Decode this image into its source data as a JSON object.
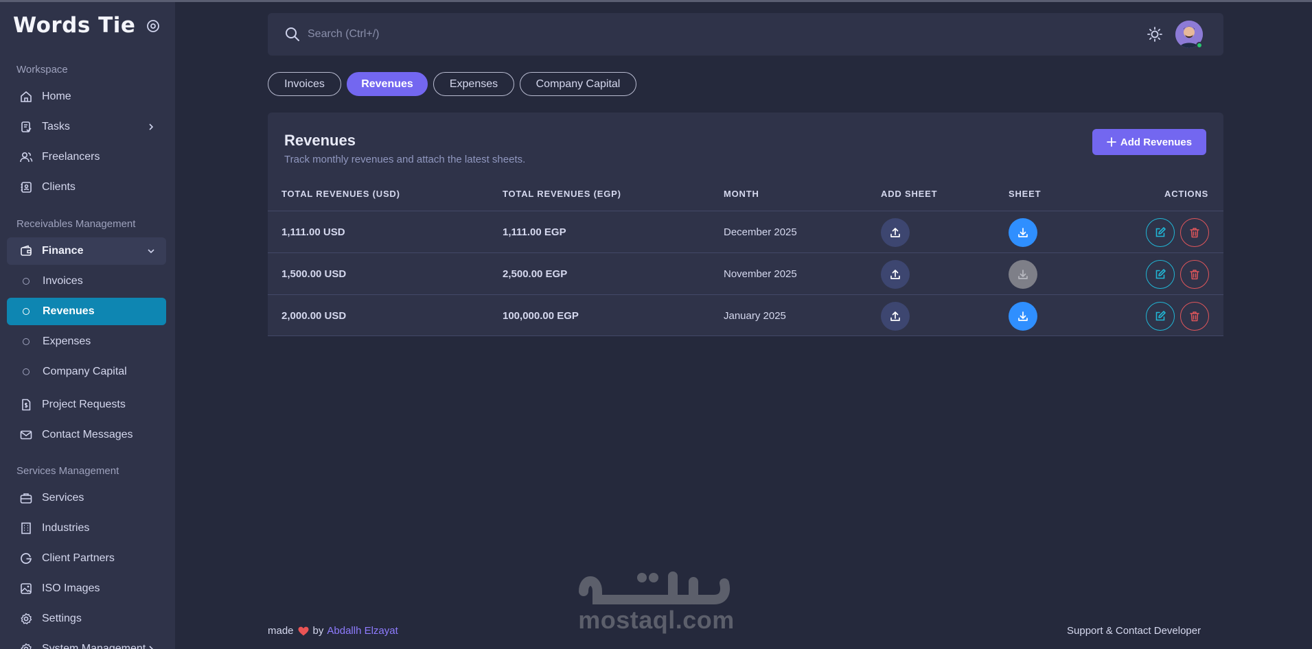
{
  "app": {
    "brand": "Words Tie"
  },
  "colors": {
    "accent": "#7367f0",
    "active_nav": "#0e86b2",
    "download": "#2f8fff",
    "edit": "#21b7d6",
    "delete": "#e0565b"
  },
  "sidebar": {
    "sections": {
      "workspace": "Workspace",
      "receivables": "Receivables Management",
      "services": "Services Management"
    },
    "workspace_items": [
      {
        "label": "Home",
        "icon": "home-icon"
      },
      {
        "label": "Tasks",
        "icon": "tasks-icon"
      },
      {
        "label": "Freelancers",
        "icon": "users-icon"
      },
      {
        "label": "Clients",
        "icon": "address-book-icon"
      }
    ],
    "finance": {
      "label": "Finance",
      "sub": [
        "Invoices",
        "Revenues",
        "Expenses",
        "Company Capital"
      ]
    },
    "receivable_items": [
      {
        "label": "Project Requests",
        "icon": "dollar-file-icon"
      },
      {
        "label": "Contact Messages",
        "icon": "mail-icon"
      }
    ],
    "service_items": [
      {
        "label": "Services",
        "icon": "briefcase-icon"
      },
      {
        "label": "Industries",
        "icon": "building-icon"
      },
      {
        "label": "Client Partners",
        "icon": "google-icon"
      },
      {
        "label": "ISO Images",
        "icon": "image-icon"
      },
      {
        "label": "Settings",
        "icon": "gear-icon"
      },
      {
        "label": "System Management",
        "icon": "gear-icon"
      }
    ]
  },
  "topbar": {
    "search_placeholder": "Search (Ctrl+/)"
  },
  "tabs": [
    "Invoices",
    "Revenues",
    "Expenses",
    "Company Capital"
  ],
  "active_tab": "Revenues",
  "card": {
    "title": "Revenues",
    "subtitle": "Track monthly revenues and attach the latest sheets.",
    "add_button": "Add Revenues"
  },
  "table": {
    "headers": [
      "TOTAL REVENUES (USD)",
      "TOTAL REVENUES (EGP)",
      "MONTH",
      "ADD SHEET",
      "SHEET",
      "ACTIONS"
    ],
    "rows": [
      {
        "usd": "1,111.00 USD",
        "egp": "1,111.00 EGP",
        "month": "December 2025",
        "sheet_available": true
      },
      {
        "usd": "1,500.00 USD",
        "egp": "2,500.00 EGP",
        "month": "November 2025",
        "sheet_available": false
      },
      {
        "usd": "2,000.00 USD",
        "egp": "100,000.00 EGP",
        "month": "January 2025",
        "sheet_available": true
      }
    ]
  },
  "footer": {
    "made": "made",
    "by": "by",
    "author": "Abdallh Elzayat",
    "support": "Support & Contact Developer"
  },
  "watermark": "mostaql.com"
}
